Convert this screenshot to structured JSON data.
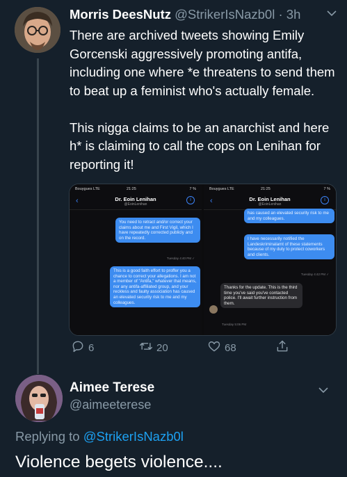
{
  "tweet1": {
    "display_name": "Morris DeesNutz",
    "handle": "@StrikerIsNazb0l",
    "separator": "·",
    "time": "3h",
    "paragraph1": "There are archived tweets showing Emily Gorcenski aggressively promoting antifa, including one where *e threatens to send them to beat up a feminist who's actually female.",
    "paragraph2": "This nigga claims to be an anarchist and here h* is claiming to call the cops on Lenihan for reporting it!",
    "media": {
      "left_phone": {
        "carrier": "Bouygues  LTE",
        "clock": "21:25",
        "battery": "7 %",
        "contact_name": "Dr. Eoin Lenihan",
        "contact_handle": "@EoinLenihan",
        "msg1": "You need to retract and/or correct your claims about me and First Vigil, which I have repeatedly corrected publicly and on the record.",
        "ts1": "Tuesday 4:40 PM ✓",
        "msg2": "This is a good faith effort to proffer you a chance to correct your allegations. I am not a member of \"Antifa,\" whatever that means, nor any antifa-affiliated group, and your reckless and faulty association has caused an elevated security risk to me and my colleagues."
      },
      "right_phone": {
        "carrier": "Bouygues  LTE",
        "clock": "21:25",
        "battery": "7 %",
        "contact_name": "Dr. Eoin Lenihan",
        "contact_handle": "@EoinLenihan",
        "msg1": "has caused an elevated security risk to me and my colleagues.",
        "msg2": "I have necessarily notified the Landeskriminalamt of these statements because of my duty to protect coworkers and clients.",
        "ts1": "Tuesday 4:42 PM ✓",
        "msg3": "Thanks for the update. This is the third time you've said you've contacted police. I'll await further instruction from them.",
        "ts2": "Tuesday 5:06 PM"
      }
    },
    "actions": {
      "reply_count": "6",
      "retweet_count": "20",
      "like_count": "68"
    }
  },
  "tweet2": {
    "display_name": "Aimee Terese",
    "handle": "@aimeeterese",
    "replying_prefix": "Replying to",
    "replying_to": "@StrikerIsNazb0l",
    "text": "Violence begets violence...."
  },
  "icons": {
    "reply": "reply-icon",
    "retweet": "retweet-icon",
    "like": "heart-icon",
    "share": "share-icon",
    "more": "chevron-down-icon"
  },
  "colors": {
    "background": "#15202b",
    "secondary_text": "#8899a6",
    "link": "#1da1f2",
    "divider": "#38444d",
    "imessage_blue": "#3d8cf0"
  }
}
